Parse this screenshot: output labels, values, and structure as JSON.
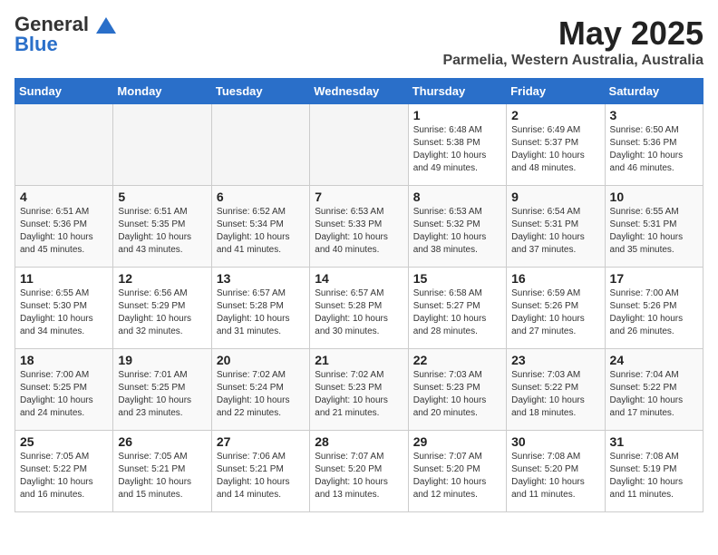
{
  "header": {
    "logo_line1": "General",
    "logo_line2": "Blue",
    "month": "May 2025",
    "location": "Parmelia, Western Australia, Australia"
  },
  "weekdays": [
    "Sunday",
    "Monday",
    "Tuesday",
    "Wednesday",
    "Thursday",
    "Friday",
    "Saturday"
  ],
  "weeks": [
    [
      {
        "day": "",
        "info": ""
      },
      {
        "day": "",
        "info": ""
      },
      {
        "day": "",
        "info": ""
      },
      {
        "day": "",
        "info": ""
      },
      {
        "day": "1",
        "info": "Sunrise: 6:48 AM\nSunset: 5:38 PM\nDaylight: 10 hours\nand 49 minutes."
      },
      {
        "day": "2",
        "info": "Sunrise: 6:49 AM\nSunset: 5:37 PM\nDaylight: 10 hours\nand 48 minutes."
      },
      {
        "day": "3",
        "info": "Sunrise: 6:50 AM\nSunset: 5:36 PM\nDaylight: 10 hours\nand 46 minutes."
      }
    ],
    [
      {
        "day": "4",
        "info": "Sunrise: 6:51 AM\nSunset: 5:36 PM\nDaylight: 10 hours\nand 45 minutes."
      },
      {
        "day": "5",
        "info": "Sunrise: 6:51 AM\nSunset: 5:35 PM\nDaylight: 10 hours\nand 43 minutes."
      },
      {
        "day": "6",
        "info": "Sunrise: 6:52 AM\nSunset: 5:34 PM\nDaylight: 10 hours\nand 41 minutes."
      },
      {
        "day": "7",
        "info": "Sunrise: 6:53 AM\nSunset: 5:33 PM\nDaylight: 10 hours\nand 40 minutes."
      },
      {
        "day": "8",
        "info": "Sunrise: 6:53 AM\nSunset: 5:32 PM\nDaylight: 10 hours\nand 38 minutes."
      },
      {
        "day": "9",
        "info": "Sunrise: 6:54 AM\nSunset: 5:31 PM\nDaylight: 10 hours\nand 37 minutes."
      },
      {
        "day": "10",
        "info": "Sunrise: 6:55 AM\nSunset: 5:31 PM\nDaylight: 10 hours\nand 35 minutes."
      }
    ],
    [
      {
        "day": "11",
        "info": "Sunrise: 6:55 AM\nSunset: 5:30 PM\nDaylight: 10 hours\nand 34 minutes."
      },
      {
        "day": "12",
        "info": "Sunrise: 6:56 AM\nSunset: 5:29 PM\nDaylight: 10 hours\nand 32 minutes."
      },
      {
        "day": "13",
        "info": "Sunrise: 6:57 AM\nSunset: 5:28 PM\nDaylight: 10 hours\nand 31 minutes."
      },
      {
        "day": "14",
        "info": "Sunrise: 6:57 AM\nSunset: 5:28 PM\nDaylight: 10 hours\nand 30 minutes."
      },
      {
        "day": "15",
        "info": "Sunrise: 6:58 AM\nSunset: 5:27 PM\nDaylight: 10 hours\nand 28 minutes."
      },
      {
        "day": "16",
        "info": "Sunrise: 6:59 AM\nSunset: 5:26 PM\nDaylight: 10 hours\nand 27 minutes."
      },
      {
        "day": "17",
        "info": "Sunrise: 7:00 AM\nSunset: 5:26 PM\nDaylight: 10 hours\nand 26 minutes."
      }
    ],
    [
      {
        "day": "18",
        "info": "Sunrise: 7:00 AM\nSunset: 5:25 PM\nDaylight: 10 hours\nand 24 minutes."
      },
      {
        "day": "19",
        "info": "Sunrise: 7:01 AM\nSunset: 5:25 PM\nDaylight: 10 hours\nand 23 minutes."
      },
      {
        "day": "20",
        "info": "Sunrise: 7:02 AM\nSunset: 5:24 PM\nDaylight: 10 hours\nand 22 minutes."
      },
      {
        "day": "21",
        "info": "Sunrise: 7:02 AM\nSunset: 5:23 PM\nDaylight: 10 hours\nand 21 minutes."
      },
      {
        "day": "22",
        "info": "Sunrise: 7:03 AM\nSunset: 5:23 PM\nDaylight: 10 hours\nand 20 minutes."
      },
      {
        "day": "23",
        "info": "Sunrise: 7:03 AM\nSunset: 5:22 PM\nDaylight: 10 hours\nand 18 minutes."
      },
      {
        "day": "24",
        "info": "Sunrise: 7:04 AM\nSunset: 5:22 PM\nDaylight: 10 hours\nand 17 minutes."
      }
    ],
    [
      {
        "day": "25",
        "info": "Sunrise: 7:05 AM\nSunset: 5:22 PM\nDaylight: 10 hours\nand 16 minutes."
      },
      {
        "day": "26",
        "info": "Sunrise: 7:05 AM\nSunset: 5:21 PM\nDaylight: 10 hours\nand 15 minutes."
      },
      {
        "day": "27",
        "info": "Sunrise: 7:06 AM\nSunset: 5:21 PM\nDaylight: 10 hours\nand 14 minutes."
      },
      {
        "day": "28",
        "info": "Sunrise: 7:07 AM\nSunset: 5:20 PM\nDaylight: 10 hours\nand 13 minutes."
      },
      {
        "day": "29",
        "info": "Sunrise: 7:07 AM\nSunset: 5:20 PM\nDaylight: 10 hours\nand 12 minutes."
      },
      {
        "day": "30",
        "info": "Sunrise: 7:08 AM\nSunset: 5:20 PM\nDaylight: 10 hours\nand 11 minutes."
      },
      {
        "day": "31",
        "info": "Sunrise: 7:08 AM\nSunset: 5:19 PM\nDaylight: 10 hours\nand 11 minutes."
      }
    ]
  ]
}
